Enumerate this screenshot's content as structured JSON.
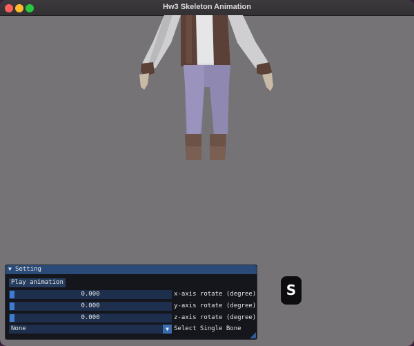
{
  "window": {
    "title": "Hw3 Skeleton Animation"
  },
  "colors": {
    "viewport_bg": "#757376",
    "panel_header": "#2a4a78",
    "button_bg": "#263c5e",
    "slider_bg": "#1d2f4c",
    "slider_grab": "#3f7cd1"
  },
  "panel": {
    "title": "Setting",
    "play_button": "Play animation",
    "sliders": [
      {
        "value": "0.000",
        "label": "x-axis rotate (degree)"
      },
      {
        "value": "0.000",
        "label": "y-axis rotate (degree)"
      },
      {
        "value": "0.000",
        "label": "z-axis rotate (degree)"
      }
    ],
    "combo": {
      "value": "None",
      "label": "Select Single Bone"
    }
  },
  "key_overlay": {
    "key": "S"
  },
  "icons": {
    "close": "close-button",
    "minimize": "minimize-button",
    "maximize": "maximize-button",
    "collapse": "triangle-down-icon",
    "combo_arrow": "triangle-down-icon"
  }
}
